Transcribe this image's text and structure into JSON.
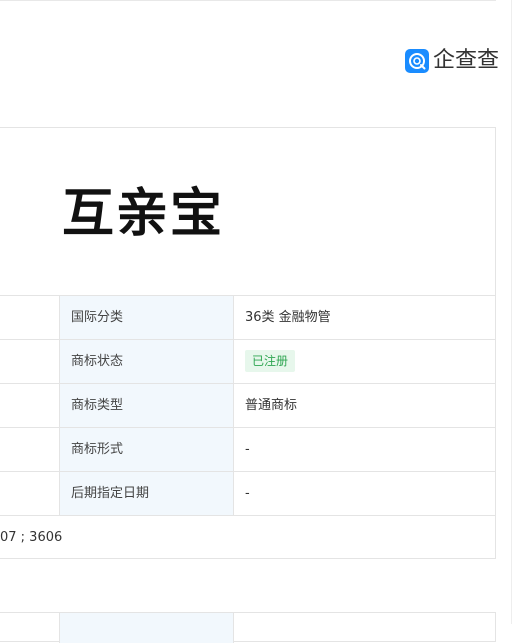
{
  "logo": {
    "text": "企查查",
    "icon_name": "qcc-logo-icon",
    "accent": "#1a8cff"
  },
  "trademark": {
    "mark_text": "互亲宝"
  },
  "details": [
    {
      "label": "国际分类",
      "value": "36类 金融物管"
    },
    {
      "label": "商标状态",
      "value": "已注册",
      "badge": true
    },
    {
      "label": "商标类型",
      "value": "普通商标"
    },
    {
      "label": "商标形式",
      "value": "-"
    },
    {
      "label": "后期指定日期",
      "value": "-"
    }
  ],
  "similar_groups": "07 ; 3606",
  "colors": {
    "label_bg": "#f2f8fd",
    "badge_bg": "#e7f7ec",
    "badge_text": "#2fa652",
    "border": "#e4e4e4"
  }
}
